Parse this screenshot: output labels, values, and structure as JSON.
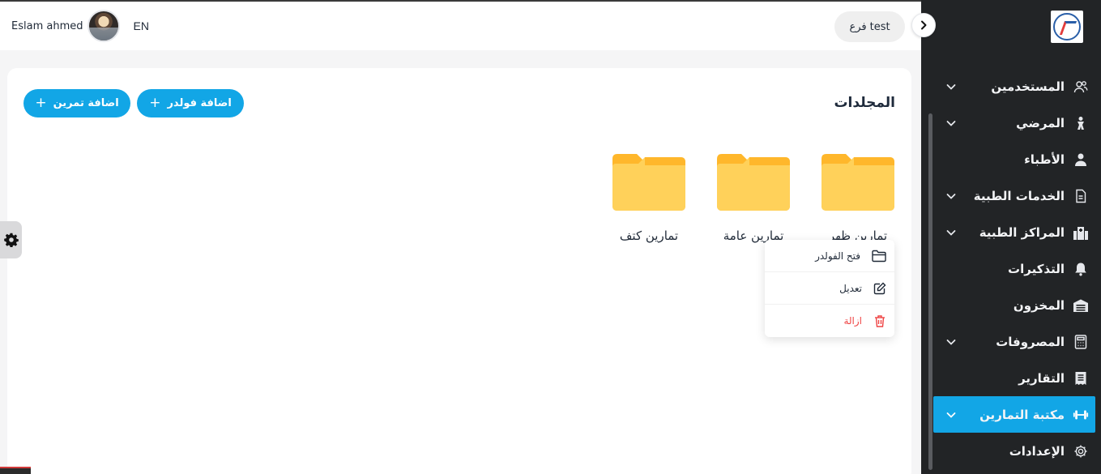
{
  "header": {
    "user_name": "Eslam ahmed",
    "language": "EN",
    "branch_prefix": "فرع",
    "branch_name": "test"
  },
  "sidebar": {
    "items": [
      {
        "label": "المستخدمين",
        "icon": "users-icon",
        "has_submenu": true
      },
      {
        "label": "المرضي",
        "icon": "patient-icon",
        "has_submenu": true
      },
      {
        "label": "الأطباء",
        "icon": "doctor-icon",
        "has_submenu": false
      },
      {
        "label": "الخدمات الطبية",
        "icon": "document-icon",
        "has_submenu": true
      },
      {
        "label": "المراكز الطبية",
        "icon": "hospital-icon",
        "has_submenu": true
      },
      {
        "label": "التذكيرات",
        "icon": "bell-icon",
        "has_submenu": false
      },
      {
        "label": "المخزون",
        "icon": "warehouse-icon",
        "has_submenu": false
      },
      {
        "label": "المصروفات",
        "icon": "calculator-icon",
        "has_submenu": true
      },
      {
        "label": "التقارير",
        "icon": "report-icon",
        "has_submenu": false
      },
      {
        "label": "مكتبة التمارين",
        "icon": "dumbbell-icon",
        "has_submenu": true,
        "active": true
      },
      {
        "label": "الإعدادات",
        "icon": "gear-icon",
        "has_submenu": false
      }
    ],
    "active_color": "#12a6e6"
  },
  "main": {
    "title": "المجلدات",
    "add_folder_label": "اضافة فولدر",
    "add_exercise_label": "اضافة تمرين",
    "folders": [
      {
        "name": "تمارين ظهر"
      },
      {
        "name": "تمارين عامة"
      },
      {
        "name": "تمارين كتف"
      }
    ],
    "context_menu": {
      "open": "فتح الفولدر",
      "edit": "تعديل",
      "delete": "ازالة"
    }
  },
  "colors": {
    "primary": "#12a6e6",
    "sidebar_bg": "#222426",
    "folder": "#ffd15a",
    "danger": "#ef4444"
  }
}
